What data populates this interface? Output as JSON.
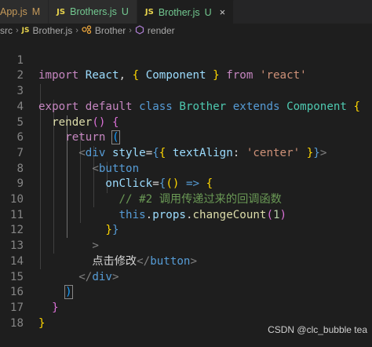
{
  "tabs": [
    {
      "icon": "JS",
      "name": "App.js",
      "status": "M",
      "active": false
    },
    {
      "icon": "JS",
      "name": "Brothers.js",
      "status": "U",
      "active": false
    },
    {
      "icon": "JS",
      "name": "Brother.js",
      "status": "U",
      "active": true,
      "close": "×"
    }
  ],
  "breadcrumb": {
    "folder": "src",
    "file_icon": "JS",
    "file": "Brother.js",
    "class_symbol": "Brother",
    "method_symbol": "render"
  },
  "line_numbers": [
    "1",
    "2",
    "3",
    "4",
    "5",
    "6",
    "7",
    "8",
    "9",
    "10",
    "11",
    "12",
    "13",
    "14",
    "15",
    "16",
    "17",
    "18"
  ],
  "code": {
    "l1": {
      "import": "import",
      "react": "React",
      "comma": ",",
      "lb": "{",
      "component": "Component",
      "rb": "}",
      "from": "from",
      "module": "'react'"
    },
    "l3": {
      "export": "export",
      "default": "default",
      "class": "class",
      "name": "Brother",
      "extends": "extends",
      "base": "Component",
      "lb": "{"
    },
    "l4": {
      "render": "render",
      "parens": "()",
      "lb": "{"
    },
    "l5": {
      "return": "return",
      "lp": "("
    },
    "l6": {
      "open": "<",
      "tag": "div",
      "attr": "style",
      "eq": "=",
      "lb1": "{",
      "lb2": "{",
      "prop": "textAlign",
      "colon": ":",
      "val": "'center'",
      "rb2": "}",
      "rb1": "}",
      "close": ">"
    },
    "l7": {
      "open": "<",
      "tag": "button"
    },
    "l8": {
      "attr": "onClick",
      "eq": "=",
      "lb": "{",
      "lp": "(",
      "rp": ")",
      "arrow": "=>",
      "lb2": "{"
    },
    "l9": {
      "comment": "// #2 调用传递过来的回调函数"
    },
    "l10": {
      "this": "this",
      "dot1": ".",
      "props": "props",
      "dot2": ".",
      "method": "changeCount",
      "lp": "(",
      "arg": "1",
      "rp": ")"
    },
    "l11": {
      "rb2": "}",
      "rb": "}"
    },
    "l12": {
      "gt": ">"
    },
    "l13": {
      "text": "点击修改",
      "close_open": "</",
      "tag": "button",
      "close": ">"
    },
    "l14": {
      "close_open": "</",
      "tag": "div",
      "close": ">"
    },
    "l15": {
      "rp": ")"
    },
    "l16": {
      "rb": "}"
    },
    "l17": {
      "rb": "}"
    }
  },
  "watermark": "CSDN @clc_bubble tea",
  "colors": {
    "background": "#1e1e1e",
    "tabbar": "#252526",
    "keyword": "#569cd6",
    "control": "#c586c0",
    "class": "#4ec9b0",
    "string": "#ce9178",
    "comment": "#6a9955"
  }
}
